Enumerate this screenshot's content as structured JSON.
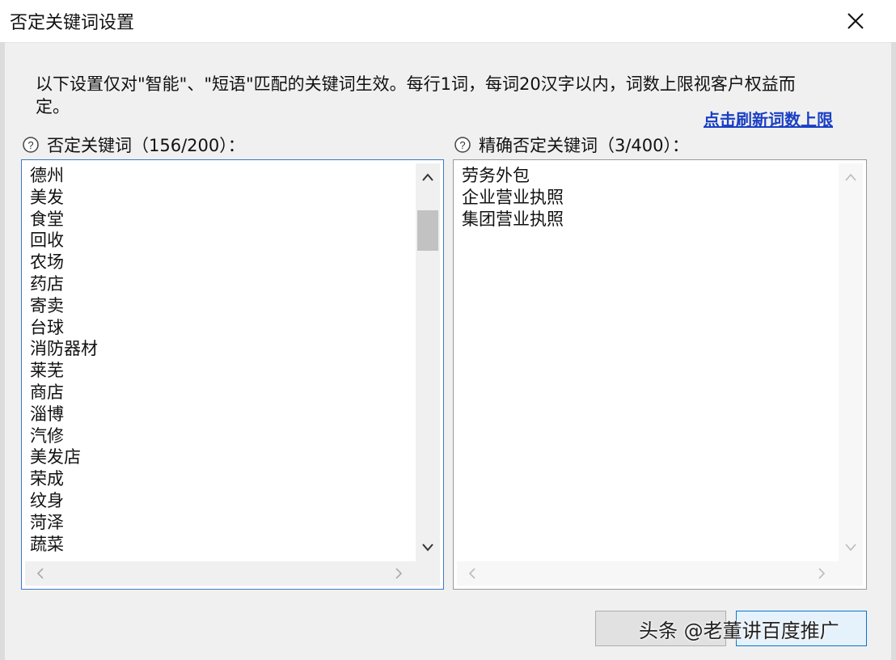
{
  "window": {
    "title": "否定关键词设置",
    "close_icon": "close-icon"
  },
  "description": "以下设置仅对\"智能\"、\"短语\"匹配的关键词生效。每行1词，每词20汉字以内，词数上限视客户权益而定。",
  "refresh_link": "点击刷新词数上限",
  "negative_keywords": {
    "label": "否定关键词（156/200）：",
    "help_icon": "help-icon",
    "items": [
      "德州",
      "美发",
      "食堂",
      "回收",
      "农场",
      "药店",
      "寄卖",
      "台球",
      "消防器材",
      "莱芜",
      "商店",
      "淄博",
      "汽修",
      "美发店",
      "荣成",
      "纹身",
      "菏泽",
      "蔬菜"
    ]
  },
  "exact_negative_keywords": {
    "label": "精确否定关键词（3/400）：",
    "help_icon": "help-icon",
    "items": [
      "劳务外包",
      "企业营业执照",
      "集团营业执照"
    ]
  },
  "watermark": "头条 @老董讲百度推广",
  "colors": {
    "link": "#1a3fc4",
    "focus_border": "#3d7bbf",
    "background": "#f0f0f0"
  }
}
